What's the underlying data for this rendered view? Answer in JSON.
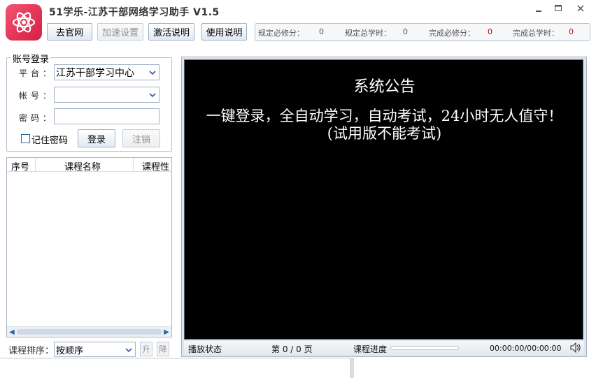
{
  "window": {
    "title": "51学乐-江苏干部网络学习助手 V1.5",
    "controls": [
      "minimize",
      "maximize",
      "close"
    ]
  },
  "toolbar": {
    "buttons": [
      {
        "label": "去官网",
        "enabled": true
      },
      {
        "label": "加速设置",
        "enabled": false
      },
      {
        "label": "激活说明",
        "enabled": true
      },
      {
        "label": "使用说明",
        "enabled": true
      }
    ]
  },
  "stats": {
    "required_credits_label": "规定必修分：",
    "required_credits_value": "0",
    "required_hours_label": "规定总学时：",
    "required_hours_value": "0",
    "done_credits_label": "完成必修分：",
    "done_credits_value": "0",
    "done_hours_label": "完成总学时：",
    "done_hours_value": "0",
    "done_value_color": "#cc0000"
  },
  "login": {
    "group_title": "账号登录",
    "platform_label": "平台：",
    "platform_value": "江苏干部学习中心",
    "account_label": "帐号：",
    "account_value": "",
    "password_label": "密码：",
    "password_value": "",
    "remember_label": "记住密码",
    "remember_checked": false,
    "login_button": "登录",
    "logout_button": "注销"
  },
  "course_list": {
    "columns": [
      "序号",
      "课程名称",
      "课程性"
    ],
    "rows": []
  },
  "sort": {
    "label": "课程排序：",
    "value": "按顺序",
    "up_button": "升",
    "down_button": "降"
  },
  "announcement": {
    "title": "系统公告",
    "body": "一键登录，全自动学习，自动考试，24小时无人值守！(试用版不能考试)",
    "background": "#000000",
    "text_color": "#ffffff"
  },
  "status_bar": {
    "play_status_label": "播放状态",
    "page_info": "第 0 / 0 页",
    "progress_label": "课程进度",
    "progress": 0,
    "time": "00:00:00/00:00:00",
    "volume_icon": "speaker-icon"
  },
  "colors": {
    "brand": "#e0294f",
    "accent": "#2e67b1"
  }
}
